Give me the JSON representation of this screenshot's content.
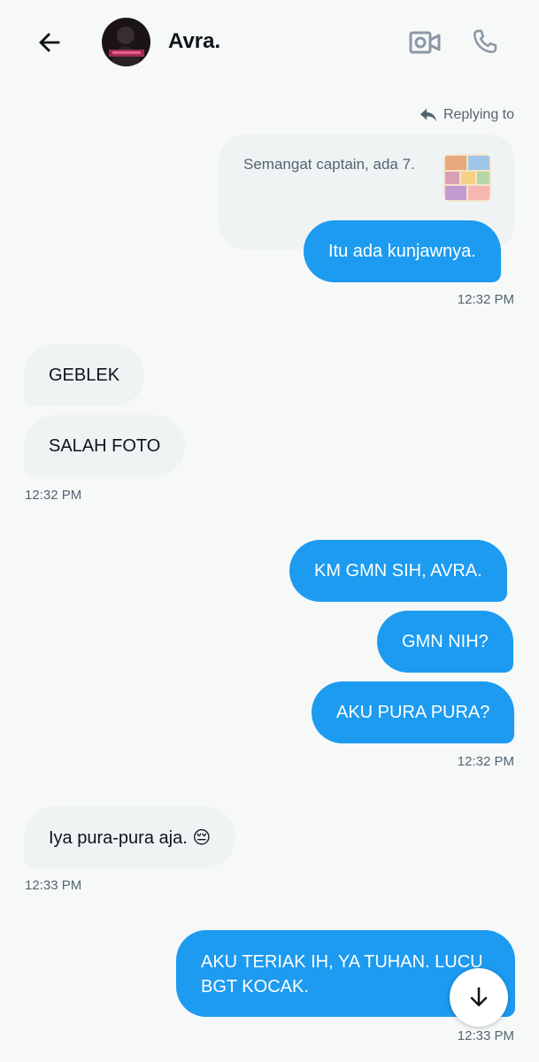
{
  "header": {
    "contact_name": "Avra.",
    "back_icon": "arrow-left-icon",
    "video_icon": "video-camera-icon",
    "call_icon": "phone-icon"
  },
  "reply": {
    "label": "Replying to",
    "quoted_text": "Semangat captain, ada 7."
  },
  "messages": [
    {
      "from": "me",
      "text": "Itu ada kunjawnya."
    },
    {
      "time": "12:32 PM"
    },
    {
      "from": "them",
      "text": "GEBLEK"
    },
    {
      "from": "them",
      "text": "SALAH FOTO"
    },
    {
      "time": "12:32 PM"
    },
    {
      "from": "me",
      "text": "KM GMN SIH, AVRA."
    },
    {
      "from": "me",
      "text": "GMN NIH?"
    },
    {
      "from": "me",
      "text": "AKU PURA PURA?"
    },
    {
      "time": "12:32 PM"
    },
    {
      "from": "them",
      "text": "Iya pura-pura aja. 😔"
    },
    {
      "time": "12:33 PM"
    },
    {
      "from": "me",
      "text": "AKU TERIAK IH, YA TUHAN. LUCU BGT KOCAK."
    },
    {
      "time": "12:33 PM"
    }
  ],
  "colors": {
    "sent_bubble": "#1d9bf0",
    "received_bubble": "#eff3f4",
    "background": "#f7f9f9",
    "muted_text": "#536471"
  }
}
